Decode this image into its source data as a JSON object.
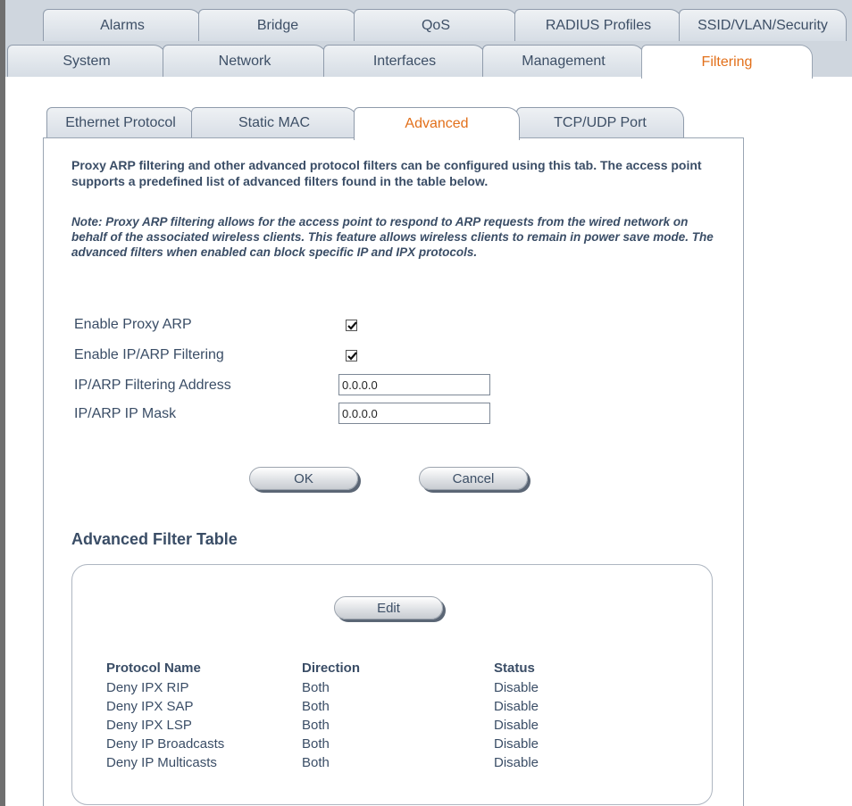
{
  "top_tabs_row1": [
    "Alarms",
    "Bridge",
    "QoS",
    "RADIUS Profiles",
    "SSID/VLAN/Security"
  ],
  "top_tabs_row2": [
    "System",
    "Network",
    "Interfaces",
    "Management",
    "Filtering"
  ],
  "active_top_tab": "Filtering",
  "sub_tabs": [
    "Ethernet Protocol",
    "Static MAC",
    "Advanced",
    "TCP/UDP Port"
  ],
  "active_sub_tab": "Advanced",
  "intro_text": "Proxy ARP filtering and other advanced protocol filters can be configured using this tab. The access point supports a predefined list of advanced filters found in the table below.",
  "note_text": "Note: Proxy ARP filtering allows for the access point to respond to ARP requests from the wired network on behalf of the associated wireless clients. This feature allows wireless clients to remain in power save mode. The advanced filters when enabled can block specific IP and IPX protocols.",
  "form": {
    "enable_proxy_arp": {
      "label": "Enable Proxy ARP",
      "checked": true
    },
    "enable_ip_arp_filtering": {
      "label": "Enable IP/ARP Filtering",
      "checked": true
    },
    "filtering_address": {
      "label": "IP/ARP Filtering Address",
      "value": "0.0.0.0"
    },
    "ip_mask": {
      "label": "IP/ARP IP Mask",
      "value": "0.0.0.0"
    }
  },
  "buttons": {
    "ok": "OK",
    "cancel": "Cancel",
    "edit": "Edit"
  },
  "filter_table": {
    "title": "Advanced Filter Table",
    "headers": [
      "Protocol Name",
      "Direction",
      "Status"
    ],
    "rows": [
      [
        "Deny IPX RIP",
        "Both",
        "Disable"
      ],
      [
        "Deny IPX SAP",
        "Both",
        "Disable"
      ],
      [
        "Deny IPX LSP",
        "Both",
        "Disable"
      ],
      [
        "Deny IP Broadcasts",
        "Both",
        "Disable"
      ],
      [
        "Deny IP Multicasts",
        "Both",
        "Disable"
      ]
    ]
  },
  "colors": {
    "active_tab_text": "#e2701b",
    "text": "#3a4d66",
    "tab_bg": "#d6dde5"
  }
}
